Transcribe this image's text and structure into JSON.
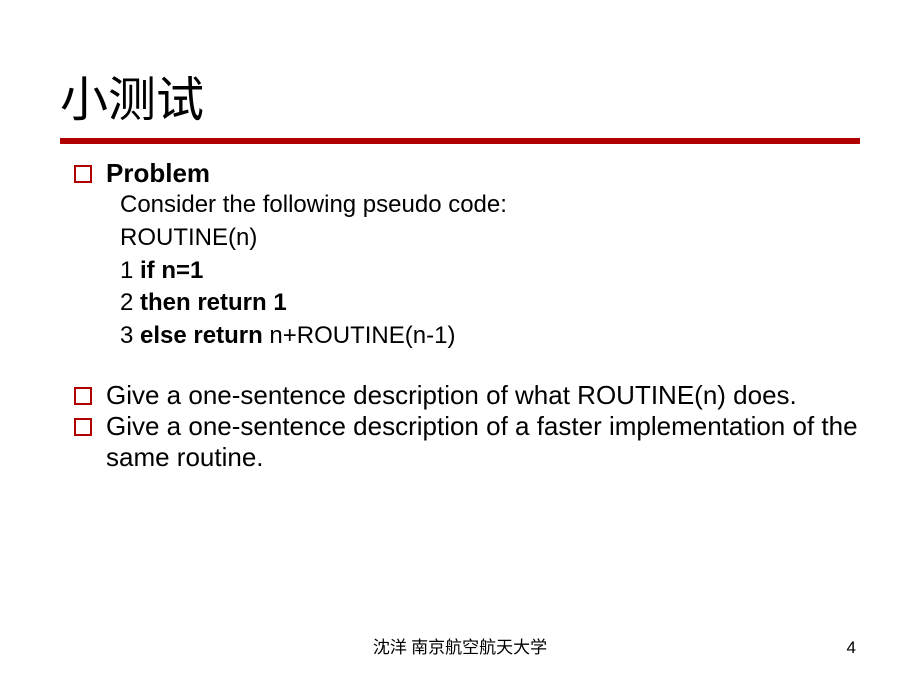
{
  "title": "小测试",
  "bullets": {
    "problem_label": "Problem",
    "problem_intro": "Consider the following pseudo code:",
    "code": {
      "header": "ROUTINE(n)",
      "line1_num": "1  ",
      "line1_kw": "if  n=1",
      "line2_num": "2    ",
      "line2_kw": "then return 1",
      "line3_num": "3    ",
      "line3_kw": "else return",
      "line3_rest": "  n+ROUTINE(n-1)"
    },
    "q1": "Give a one-sentence description of what ROUTINE(n) does.",
    "q2": "Give a one-sentence description of a faster implementation of the same routine."
  },
  "footer": "沈洋  南京航空航天大学",
  "page_number": "4"
}
